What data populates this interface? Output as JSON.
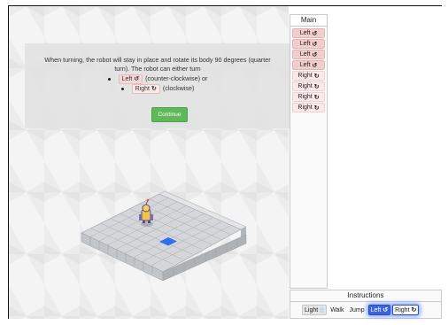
{
  "dialog": {
    "text": "When turning, the robot will stay in place and rotate its body 90 degrees (quarter turn). The robot can either turn",
    "options": [
      {
        "chip": "Left",
        "icon": "rotate-ccw-icon",
        "desc": "(counter-clockwise) or"
      },
      {
        "chip": "Right",
        "icon": "rotate-cw-icon",
        "desc": "(clockwise)"
      }
    ],
    "continue_label": "Continue"
  },
  "main_panel": {
    "title": "Main",
    "items": [
      {
        "label": "Left",
        "dir": "left"
      },
      {
        "label": "Left",
        "dir": "left"
      },
      {
        "label": "Left",
        "dir": "left"
      },
      {
        "label": "Left",
        "dir": "left"
      },
      {
        "label": "Right",
        "dir": "right"
      },
      {
        "label": "Right",
        "dir": "right"
      },
      {
        "label": "Right",
        "dir": "right"
      },
      {
        "label": "Right",
        "dir": "right"
      }
    ]
  },
  "instructions": {
    "title": "Instructions",
    "light_label": "Light",
    "walk_label": "Walk",
    "jump_label": "Jump",
    "left_label": "Left",
    "right_label": "Right"
  },
  "glyphs": {
    "ccw": "↺",
    "cw": "↻"
  },
  "colors": {
    "left_chip": "#f3cccc",
    "right_chip": "#fbe8e8",
    "continue": "#5fb85c",
    "highlight": "#3d63d8",
    "target_tile": "#2f6ff0"
  }
}
